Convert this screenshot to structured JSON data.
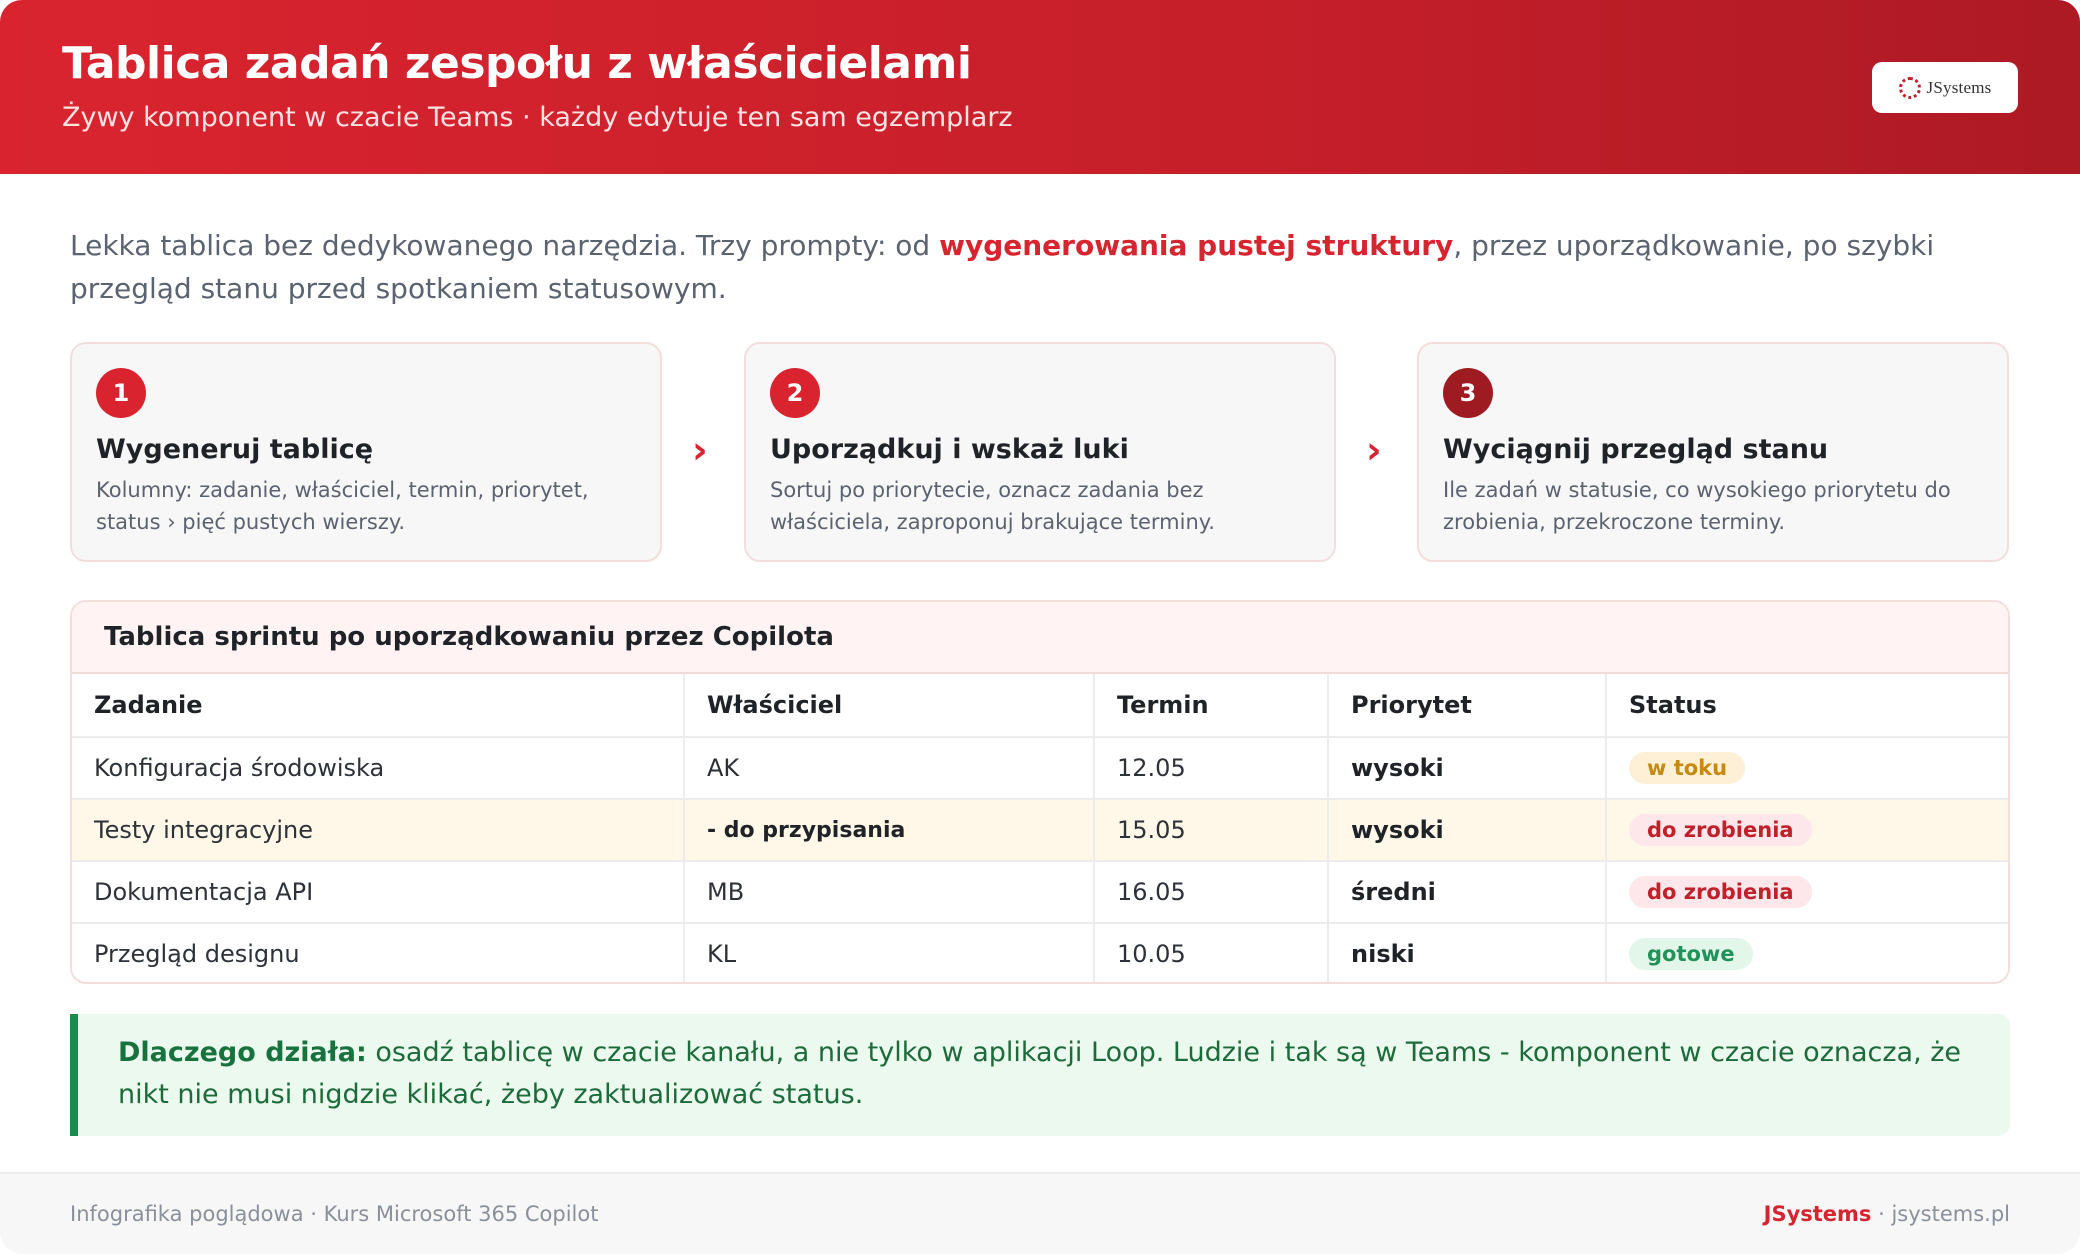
{
  "header": {
    "title": "Tablica zadań zespołu z właścicielami",
    "subtitle": "Żywy komponent w czacie Teams · każdy edytuje ten sam egzemplarz",
    "logo_text": "JSystems"
  },
  "intro": {
    "before": "Lekka tablica bez dedykowanego narzędzia. Trzy prompty: od ",
    "highlight": "wygenerowania pustej struktury",
    "after": ", przez uporządkowanie, po szybki przegląd stanu przed spotkaniem statusowym."
  },
  "steps": [
    {
      "number": "1",
      "title": "Wygeneruj tablicę",
      "description": "Kolumny: zadanie, właściciel, termin, priorytet, status › pięć pustych wierszy.",
      "color": "#d9242f"
    },
    {
      "number": "2",
      "title": "Uporządkuj i wskaż luki",
      "description": "Sortuj po priorytecie, oznacz zadania bez właściciela, zaproponuj brakujące terminy.",
      "color": "#d9242f"
    },
    {
      "number": "3",
      "title": "Wyciągnij przegląd stanu",
      "description": "Ile zadań w statusie, co wysokiego priorytetu do zrobienia, przekroczone terminy.",
      "color": "#9e1b22"
    }
  ],
  "arrow_glyph": "›",
  "table": {
    "title": "Tablica sprintu po uporządkowaniu przez Copilota",
    "columns": [
      "Zadanie",
      "Właściciel",
      "Termin",
      "Priorytet",
      "Status"
    ],
    "rows": [
      {
        "task": "Konfiguracja środowiska",
        "owner": "AK",
        "due": "12.05",
        "priority": "wysoki",
        "status": "w toku",
        "status_kind": "progress"
      },
      {
        "task": "Testy integracyjne",
        "owner": "- do przypisania",
        "due": "15.05",
        "priority": "wysoki",
        "status": "do zrobienia",
        "status_kind": "todo"
      },
      {
        "task": "Dokumentacja API",
        "owner": "MB",
        "due": "16.05",
        "priority": "średni",
        "status": "do zrobienia",
        "status_kind": "todo"
      },
      {
        "task": "Przegląd designu",
        "owner": "KL",
        "due": "10.05",
        "priority": "niski",
        "status": "gotowe",
        "status_kind": "done"
      }
    ]
  },
  "why": {
    "label": "Dlaczego działa:",
    "text": " osadź tablicę w czacie kanału, a nie tylko w aplikacji Loop. Ludzie i tak są w Teams - komponent w czacie oznacza, że nikt nie musi nigdzie klikać, żeby zaktualizować status."
  },
  "footer": {
    "left": "Infografika poglądowa · Kurs Microsoft 365 Copilot",
    "brand": "JSystems",
    "right_suffix": " · jsystems.pl"
  },
  "colors": {
    "accent": "#d9242f",
    "green": "#1f8a4c"
  }
}
